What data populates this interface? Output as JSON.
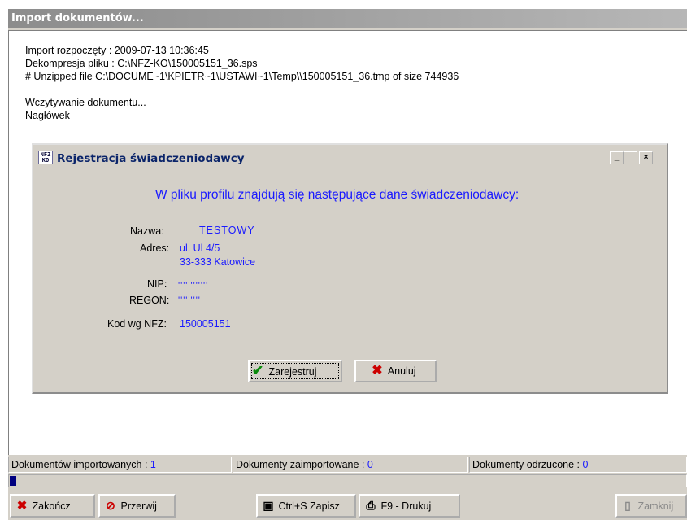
{
  "window": {
    "title": "Import dokumentów..."
  },
  "log": {
    "lines": [
      "Import rozpoczęty : 2009-07-13 10:36:45",
      "Dekompresja pliku : C:\\NFZ-KO\\150005151_36.sps",
      "# Unzipped file C:\\DOCUME~1\\KPIETR~1\\USTAWI~1\\Temp\\\\150005151_36.tmp of size 744936",
      "",
      "Wczytywanie dokumentu...",
      "Nagłówek"
    ]
  },
  "dialog": {
    "title": "Rejestracja świadczeniodawcy",
    "icon_text": [
      "NFZ",
      "KO"
    ],
    "heading": "W pliku profilu znajdują się następujące dane świadczeniodawcy:",
    "fields": {
      "nazwa_label": "Nazwa:",
      "nazwa_value": "TESTOWY",
      "adres_label": "Adres:",
      "adres_line1": "ul. Ul 4/5",
      "adres_line2": "33-333 Katowice",
      "nip_label": "NIP:",
      "nip_value": "''''''''''''",
      "regon_label": "REGON:",
      "regon_value": "'''''''''",
      "kod_label": "Kod wg NFZ:",
      "kod_value": "150005151"
    },
    "buttons": {
      "register": "Zarejestruj",
      "cancel": "Anuluj"
    },
    "window_controls": {
      "minimize": "_",
      "maximize": "□",
      "close": "×"
    }
  },
  "status": {
    "imported_label": "Dokumentów importowanych :",
    "imported_count": "1",
    "saved_label": "Dokumenty zaimportowane :",
    "saved_count": "0",
    "rejected_label": "Dokumenty odrzucone :",
    "rejected_count": "0"
  },
  "progress": {
    "fraction": 0.01
  },
  "toolbar": {
    "finish": "Zakończ",
    "stop": "Przerwij",
    "save": "Ctrl+S Zapisz",
    "print": "F9 - Drukuj",
    "close": "Zamknij"
  },
  "colors": {
    "accent": "#1a1aff",
    "title_text": "#0a246a",
    "progress": "#000080"
  }
}
